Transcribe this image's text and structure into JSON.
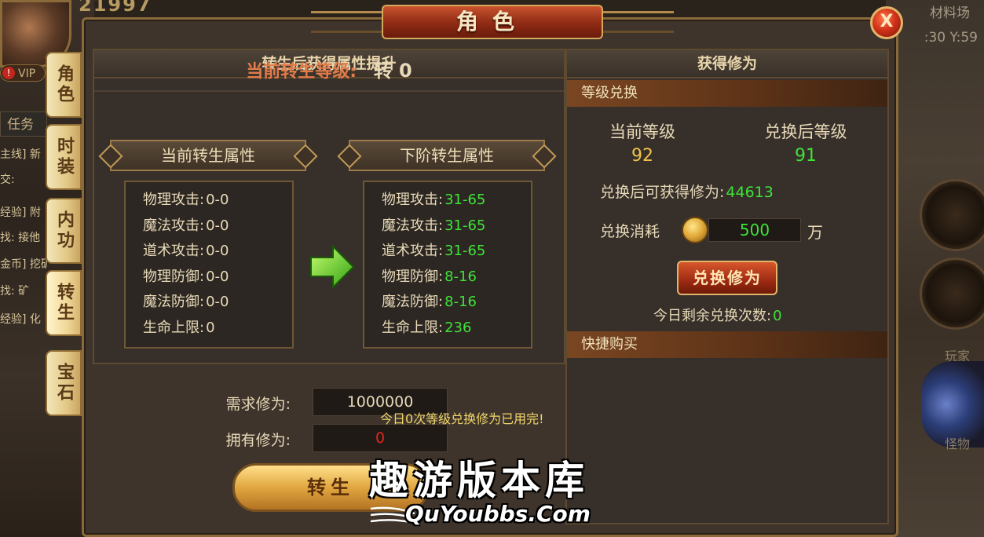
{
  "hud": {
    "score": "21997",
    "vip": "VIP",
    "quest_tab": "任务",
    "quest_lines": [
      "主线] 新",
      "交:",
      "经验] 附",
      "找: 接他",
      "金币] 挖矿",
      "找: 矿",
      "经验] 化"
    ],
    "map_name": "材料场",
    "timer": ":30 Y:59",
    "label_player": "玩家",
    "label_monster": "怪物"
  },
  "side_tabs": [
    {
      "label": "角色",
      "active": false
    },
    {
      "label": "时装",
      "active": false
    },
    {
      "label": "内功",
      "active": false
    },
    {
      "label": "转生",
      "active": true
    },
    {
      "label": "宝石",
      "active": false
    }
  ],
  "window": {
    "title": "角色",
    "close_label": "X"
  },
  "left_panel": {
    "header": "转生后获得属性提升",
    "level_label": "当前转生等级:",
    "level_value": "转 0",
    "current_ribbon": "当前转生属性",
    "next_ribbon": "下阶转生属性",
    "current_attrs": [
      {
        "name": "物理攻击:",
        "value": "0-0"
      },
      {
        "name": "魔法攻击:",
        "value": "0-0"
      },
      {
        "name": "道术攻击:",
        "value": "0-0"
      },
      {
        "name": "物理防御:",
        "value": "0-0"
      },
      {
        "name": "魔法防御:",
        "value": "0-0"
      },
      {
        "name": "生命上限:",
        "value": "0"
      }
    ],
    "next_attrs": [
      {
        "name": "物理攻击:",
        "value": "31-65"
      },
      {
        "name": "魔法攻击:",
        "value": "31-65"
      },
      {
        "name": "道术攻击:",
        "value": "31-65"
      },
      {
        "name": "物理防御:",
        "value": "8-16"
      },
      {
        "name": "魔法防御:",
        "value": "8-16"
      },
      {
        "name": "生命上限:",
        "value": "236"
      }
    ],
    "required_label": "需求修为:",
    "required_value": "1000000",
    "owned_label": "拥有修为:",
    "owned_value": "0",
    "notice": "今日0次等级兑换修为已用完!",
    "rebirth_button": "转生"
  },
  "right_panel": {
    "header": "获得修为",
    "exchange_section": "等级兑换",
    "current_level_label": "当前等级",
    "current_level_value": "92",
    "after_level_label": "兑换后等级",
    "after_level_value": "91",
    "gain_label": "兑换后可获得修为:",
    "gain_value": "44613",
    "cost_label": "兑换消耗",
    "cost_value": "500",
    "cost_unit": "万",
    "exchange_button": "兑换修为",
    "remaining_label": "今日剩余兑换次数:",
    "remaining_value": "0",
    "quick_buy_section": "快捷购买"
  },
  "watermark": {
    "cn": "趣游版本库",
    "en": "QuYoubbs.Com"
  },
  "colors": {
    "green_value": "#3fe23a",
    "red_value": "#e2261c",
    "orange_label": "#e07b4a",
    "gold_accent": "#d6a85c"
  }
}
